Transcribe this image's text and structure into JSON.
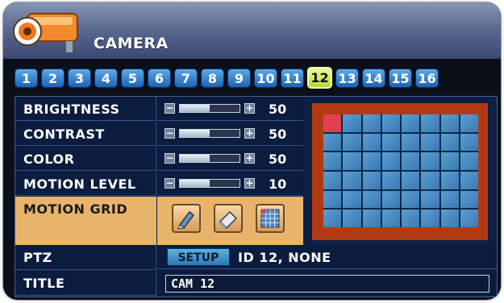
{
  "window": {
    "title": "CAMERA",
    "icon": "camera-icon"
  },
  "tabs": [
    "1",
    "2",
    "3",
    "4",
    "5",
    "6",
    "7",
    "8",
    "9",
    "10",
    "11",
    "12",
    "13",
    "14",
    "15",
    "16"
  ],
  "active_tab": "12",
  "settings": [
    {
      "label": "BRIGHTNESS",
      "value": "50",
      "level": 0.5
    },
    {
      "label": "CONTRAST",
      "value": "50",
      "level": 0.5
    },
    {
      "label": "COLOR",
      "value": "50",
      "level": 0.5
    },
    {
      "label": "MOTION LEVEL",
      "value": "10",
      "level": 0.5
    }
  ],
  "motion_grid": {
    "label": "MOTION GRID",
    "buttons": [
      "pencil-icon",
      "eraser-icon",
      "grid-icon"
    ],
    "cols": 8,
    "rows": 6,
    "marked_cells": [
      [
        0,
        0
      ]
    ]
  },
  "ptz": {
    "label": "PTZ",
    "button": "SETUP",
    "status": "ID 12, NONE"
  },
  "title_setting": {
    "label": "TITLE",
    "value": "CAM 12"
  },
  "colors": {
    "accent": "#e8b36b",
    "panel": "#0e1f45",
    "active_tab": "#c7e84a",
    "preview_border": "#b23a13"
  }
}
